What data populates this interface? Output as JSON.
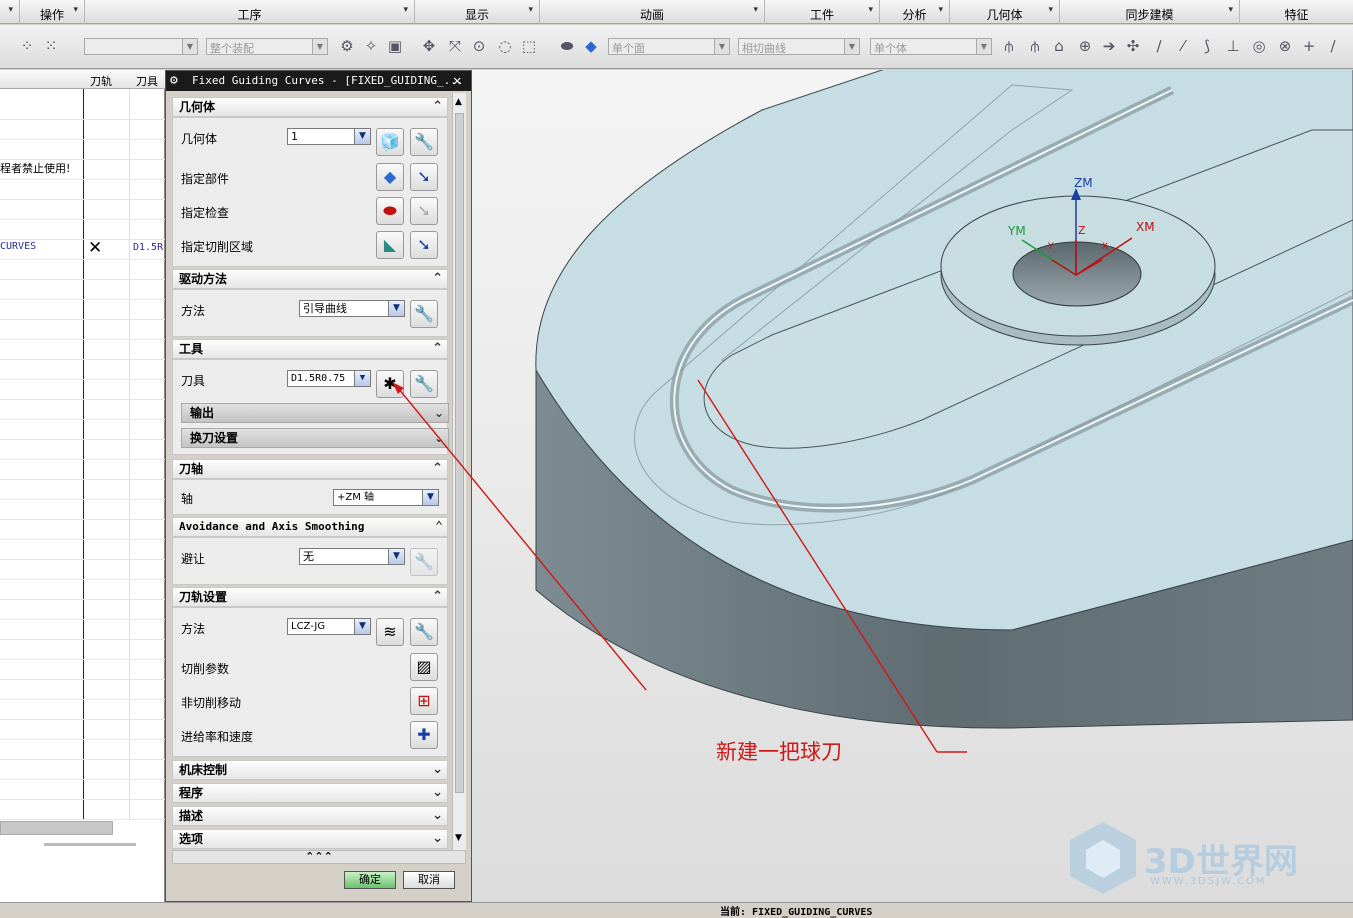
{
  "ribbon": {
    "groups": [
      "操作",
      "工序",
      "显示",
      "动画",
      "工件",
      "分析",
      "几何体",
      "同步建模",
      "特征"
    ],
    "top_partial": [
      "几何体",
      "特征"
    ]
  },
  "toolbar": {
    "combo1": "",
    "combo2": "整个装配",
    "combo3": "单个面",
    "combo4": "相切曲线",
    "combo5": "单个体"
  },
  "navigator": {
    "col_toolpath": "刀轨",
    "col_tool": "刀具",
    "warning_text": "程者禁止使用!",
    "op_name": "CURVES",
    "op_status": "✕",
    "op_tool": "D1.5R"
  },
  "dialog": {
    "title": "Fixed Guiding Curves - [FIXED_GUIDING_...",
    "close": "✕",
    "geometry": {
      "header": "几何体",
      "geometry_label": "几何体",
      "geometry_value": "1",
      "part_label": "指定部件",
      "check_label": "指定检查",
      "cut_area_label": "指定切削区域"
    },
    "drive": {
      "header": "驱动方法",
      "method_label": "方法",
      "method_value": "引导曲线"
    },
    "tool": {
      "header": "工具",
      "tool_label": "刀具",
      "tool_value": "D1.5R0.75",
      "output_label": "输出",
      "tool_change_label": "换刀设置"
    },
    "axis": {
      "header": "刀轴",
      "axis_label": "轴",
      "axis_value": "+ZM 轴"
    },
    "avoidance": {
      "header": "Avoidance and Axis Smoothing",
      "avoid_label": "避让",
      "avoid_value": "无"
    },
    "path": {
      "header": "刀轨设置",
      "method_label": "方法",
      "method_value": "LCZ-JG",
      "cut_params": "切削参数",
      "non_cut": "非切削移动",
      "feeds": "进给率和速度"
    },
    "collapsed": [
      "机床控制",
      "程序",
      "描述",
      "选项"
    ],
    "more": "⌃⌃⌃",
    "ok": "确定",
    "cancel": "取消"
  },
  "viewport": {
    "annotation": "新建一把球刀",
    "axes": {
      "zm": "ZM",
      "ym": "YM",
      "xm": "XM",
      "z": "Z",
      "y": "Y",
      "x": "X"
    },
    "watermark": "3D世界网",
    "watermark_url": "WWW.3DSJW.COM"
  },
  "status": {
    "text": "当前: FIXED_GUIDING_CURVES"
  },
  "colors": {
    "annotation": "#d01818",
    "part_top": "#c6dde3",
    "part_side": "#6b7a80",
    "accent": "#1a3fa0"
  }
}
